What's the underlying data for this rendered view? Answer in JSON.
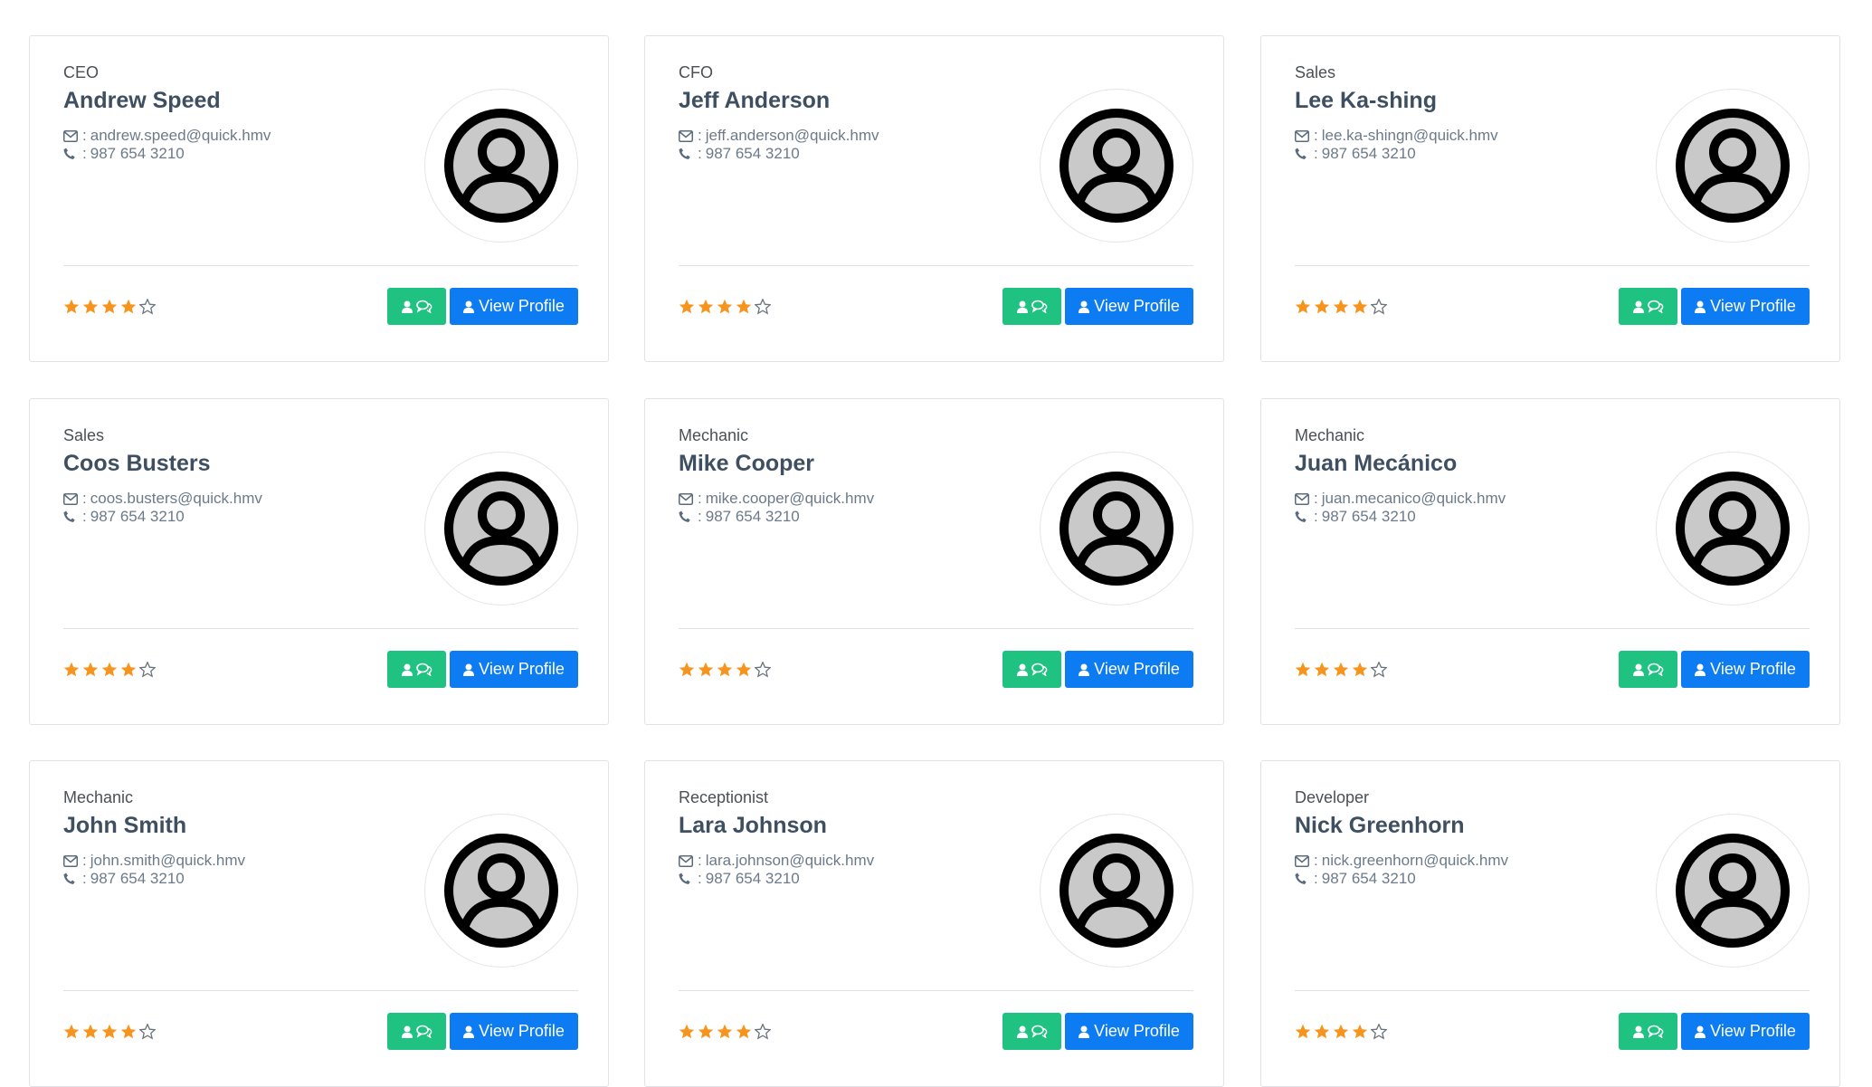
{
  "icons": {
    "email": "envelope-icon",
    "phone": "phone-icon",
    "star_full": "star-icon",
    "star_empty": "star-outline-icon",
    "user": "user-icon",
    "chat": "chat-icon"
  },
  "colors": {
    "star": "#f7941d",
    "chat_button": "#1fc281",
    "view_button": "#0d7cf2",
    "text_dark": "#3d4f60"
  },
  "separator": " : ",
  "view_label": "View Profile",
  "max_rating": 5,
  "staff": [
    {
      "role": "CEO",
      "name": "Andrew Speed",
      "email": "andrew.speed@quick.hmv",
      "phone": "987 654 3210",
      "rating": 4
    },
    {
      "role": "CFO",
      "name": "Jeff Anderson",
      "email": "jeff.anderson@quick.hmv",
      "phone": "987 654 3210",
      "rating": 4
    },
    {
      "role": "Sales",
      "name": "Lee Ka-shing",
      "email": "lee.ka-shingn@quick.hmv",
      "phone": "987 654 3210",
      "rating": 4
    },
    {
      "role": "Sales",
      "name": "Coos Busters",
      "email": "coos.busters@quick.hmv",
      "phone": "987 654 3210",
      "rating": 4
    },
    {
      "role": "Mechanic",
      "name": "Mike Cooper",
      "email": "mike.cooper@quick.hmv",
      "phone": "987 654 3210",
      "rating": 4
    },
    {
      "role": "Mechanic",
      "name": "Juan Mecánico",
      "email": "juan.mecanico@quick.hmv",
      "phone": "987 654 3210",
      "rating": 4
    },
    {
      "role": "Mechanic",
      "name": "John Smith",
      "email": "john.smith@quick.hmv",
      "phone": "987 654 3210",
      "rating": 4
    },
    {
      "role": "Receptionist",
      "name": "Lara Johnson",
      "email": "lara.johnson@quick.hmv",
      "phone": "987 654 3210",
      "rating": 4
    },
    {
      "role": "Developer",
      "name": "Nick Greenhorn",
      "email": "nick.greenhorn@quick.hmv",
      "phone": "987 654 3210",
      "rating": 4
    }
  ]
}
